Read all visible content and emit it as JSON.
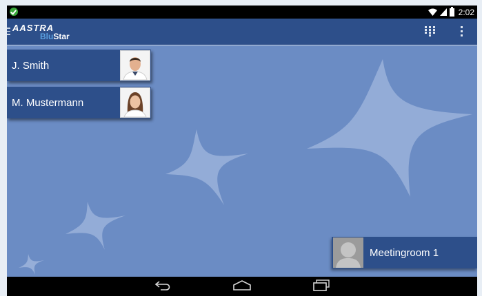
{
  "status_bar": {
    "time": "2:02",
    "icons": [
      "check-circle-icon",
      "wifi-icon",
      "signal-icon",
      "battery-icon"
    ]
  },
  "app_bar": {
    "logo_text": "AASTRA",
    "logo_sub_prefix": "Blu",
    "logo_sub_suffix": "Star",
    "actions": [
      "dialpad-icon",
      "overflow-menu-icon"
    ]
  },
  "contacts": [
    {
      "name": "J. Smith",
      "photo": "male-contact-photo"
    },
    {
      "name": "M. Mustermann",
      "photo": "female-contact-photo"
    }
  ],
  "room": {
    "name": "Meetingroom 1",
    "photo": "default-avatar-icon"
  },
  "nav_bar": {
    "buttons": [
      "back-icon",
      "home-icon",
      "recent-apps-icon"
    ]
  },
  "colors": {
    "accent": "#2d4f8a",
    "background": "#6b8cc4",
    "status_ok": "#3aa83a"
  }
}
